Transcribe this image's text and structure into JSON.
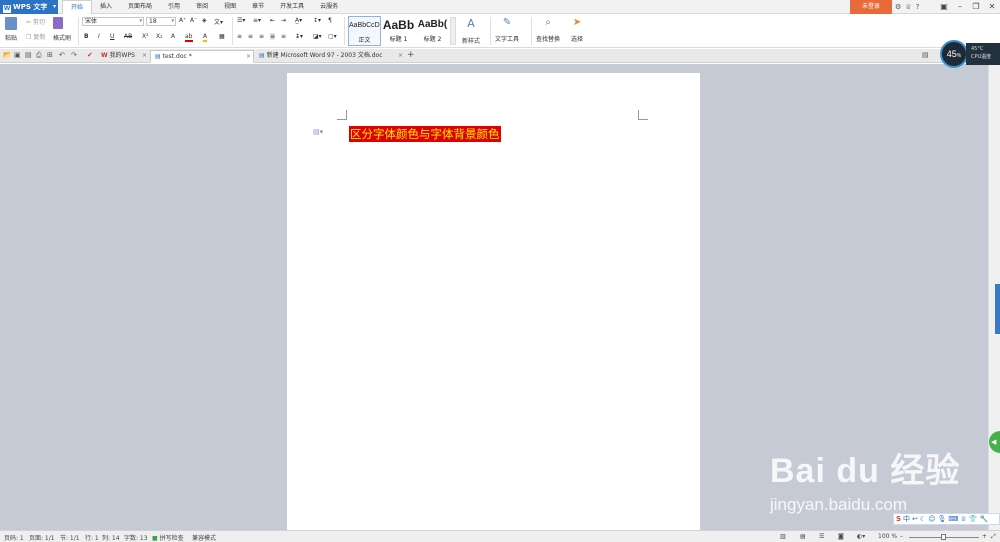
{
  "app": {
    "title": "WPS 文字",
    "dropdown_icon": "chevron-down-icon"
  },
  "menu_tabs": [
    "开始",
    "插入",
    "页面布局",
    "引用",
    "审阅",
    "视图",
    "章节",
    "开发工具",
    "云服务"
  ],
  "login_label": "未登录",
  "ribbon": {
    "paste": "粘贴",
    "cut": "剪切",
    "copy": "复制",
    "format_painter": "格式刷",
    "font_name": "宋体",
    "font_size": "18",
    "bold": "B",
    "italic": "I",
    "underline": "U",
    "strike": "AB",
    "superscript": "X²",
    "subscript": "X₂",
    "styles": [
      {
        "preview": "AaBbCcDd",
        "label": "正文"
      },
      {
        "preview": "AaBb",
        "label": "标题 1"
      },
      {
        "preview": "AaBb(",
        "label": "标题 2"
      }
    ],
    "new_style": "新样式",
    "text_tools": "文字工具",
    "find_replace": "查找替换",
    "select": "选择"
  },
  "tabs": [
    {
      "label": "我的WPS"
    },
    {
      "label": "test.doc *"
    },
    {
      "label": "新建 Microsoft Word 97 - 2003 文档.doc"
    }
  ],
  "cpu_widget": {
    "usage": "45",
    "unit": "%",
    "temp": "45°C",
    "label": "CPU温度"
  },
  "document": {
    "text": "区分字体颜色与字体背景颜色",
    "font_color": "#ffee00",
    "highlight_color": "#e00000"
  },
  "watermark": {
    "brand": "Bai du 经验",
    "url": "jingyan.baidu.com"
  },
  "status": {
    "page_num": "页码: 1",
    "pages": "页面: 1/1",
    "section": "节: 1/1",
    "line": "行: 1",
    "col": "列: 14",
    "words": "字数: 13",
    "spell": "拼写检查",
    "compat": "兼容模式",
    "zoom": "100 %"
  }
}
